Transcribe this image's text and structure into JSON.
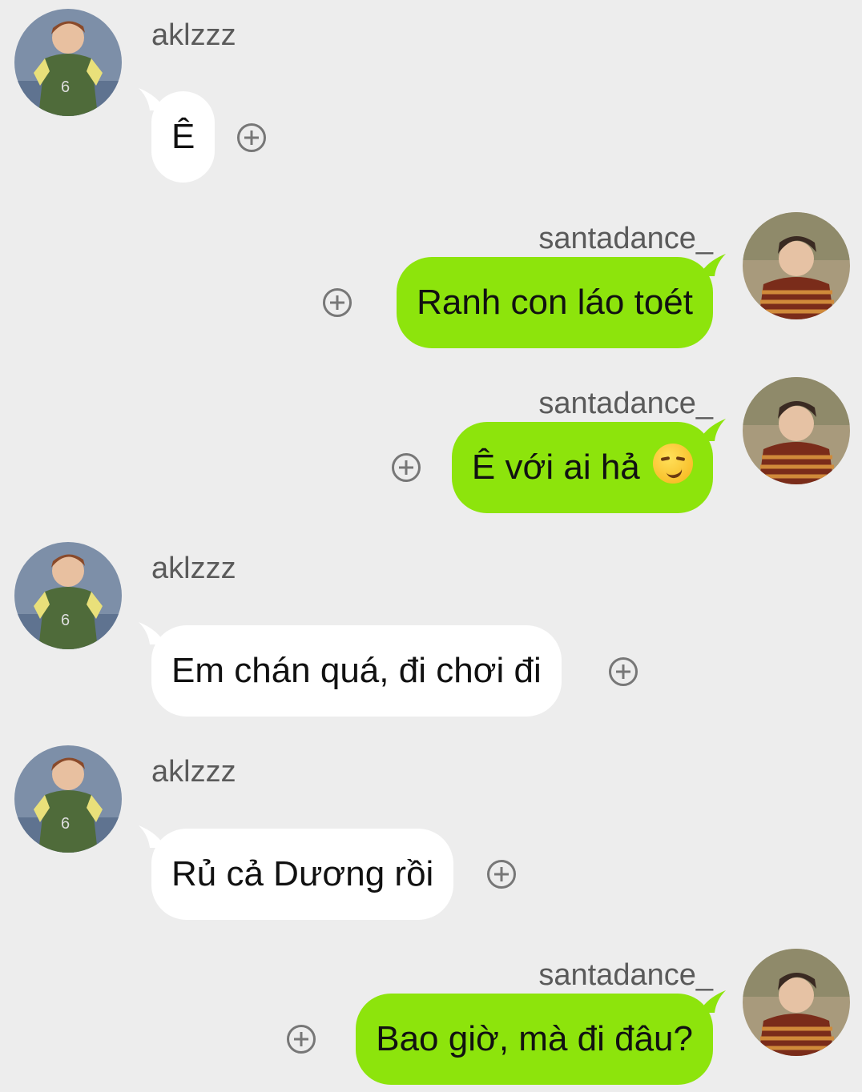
{
  "messages": [
    {
      "sender": "aklzzz",
      "side": "left",
      "text": "Ê"
    },
    {
      "sender": "santadance_",
      "side": "right",
      "text": "Ranh con láo toét"
    },
    {
      "sender": "santadance_",
      "side": "right",
      "text": "Ê với ai hả",
      "emoji": "smirking-face-emoji"
    },
    {
      "sender": "aklzzz",
      "side": "left",
      "text": "Em chán quá, đi chơi đi"
    },
    {
      "sender": "aklzzz",
      "side": "left",
      "text": "Rủ cả Dương rồi"
    },
    {
      "sender": "santadance_",
      "side": "right",
      "text": "Bao giờ, mà đi đâu?"
    }
  ],
  "colors": {
    "background": "#ededed",
    "incoming_bubble": "#ffffff",
    "outgoing_bubble": "#8de40c",
    "plus_icon": "#777777"
  },
  "icons": {
    "add": "plus-circle-icon",
    "avatar_left": "avatar-aklzzz",
    "avatar_right": "avatar-santadance"
  }
}
